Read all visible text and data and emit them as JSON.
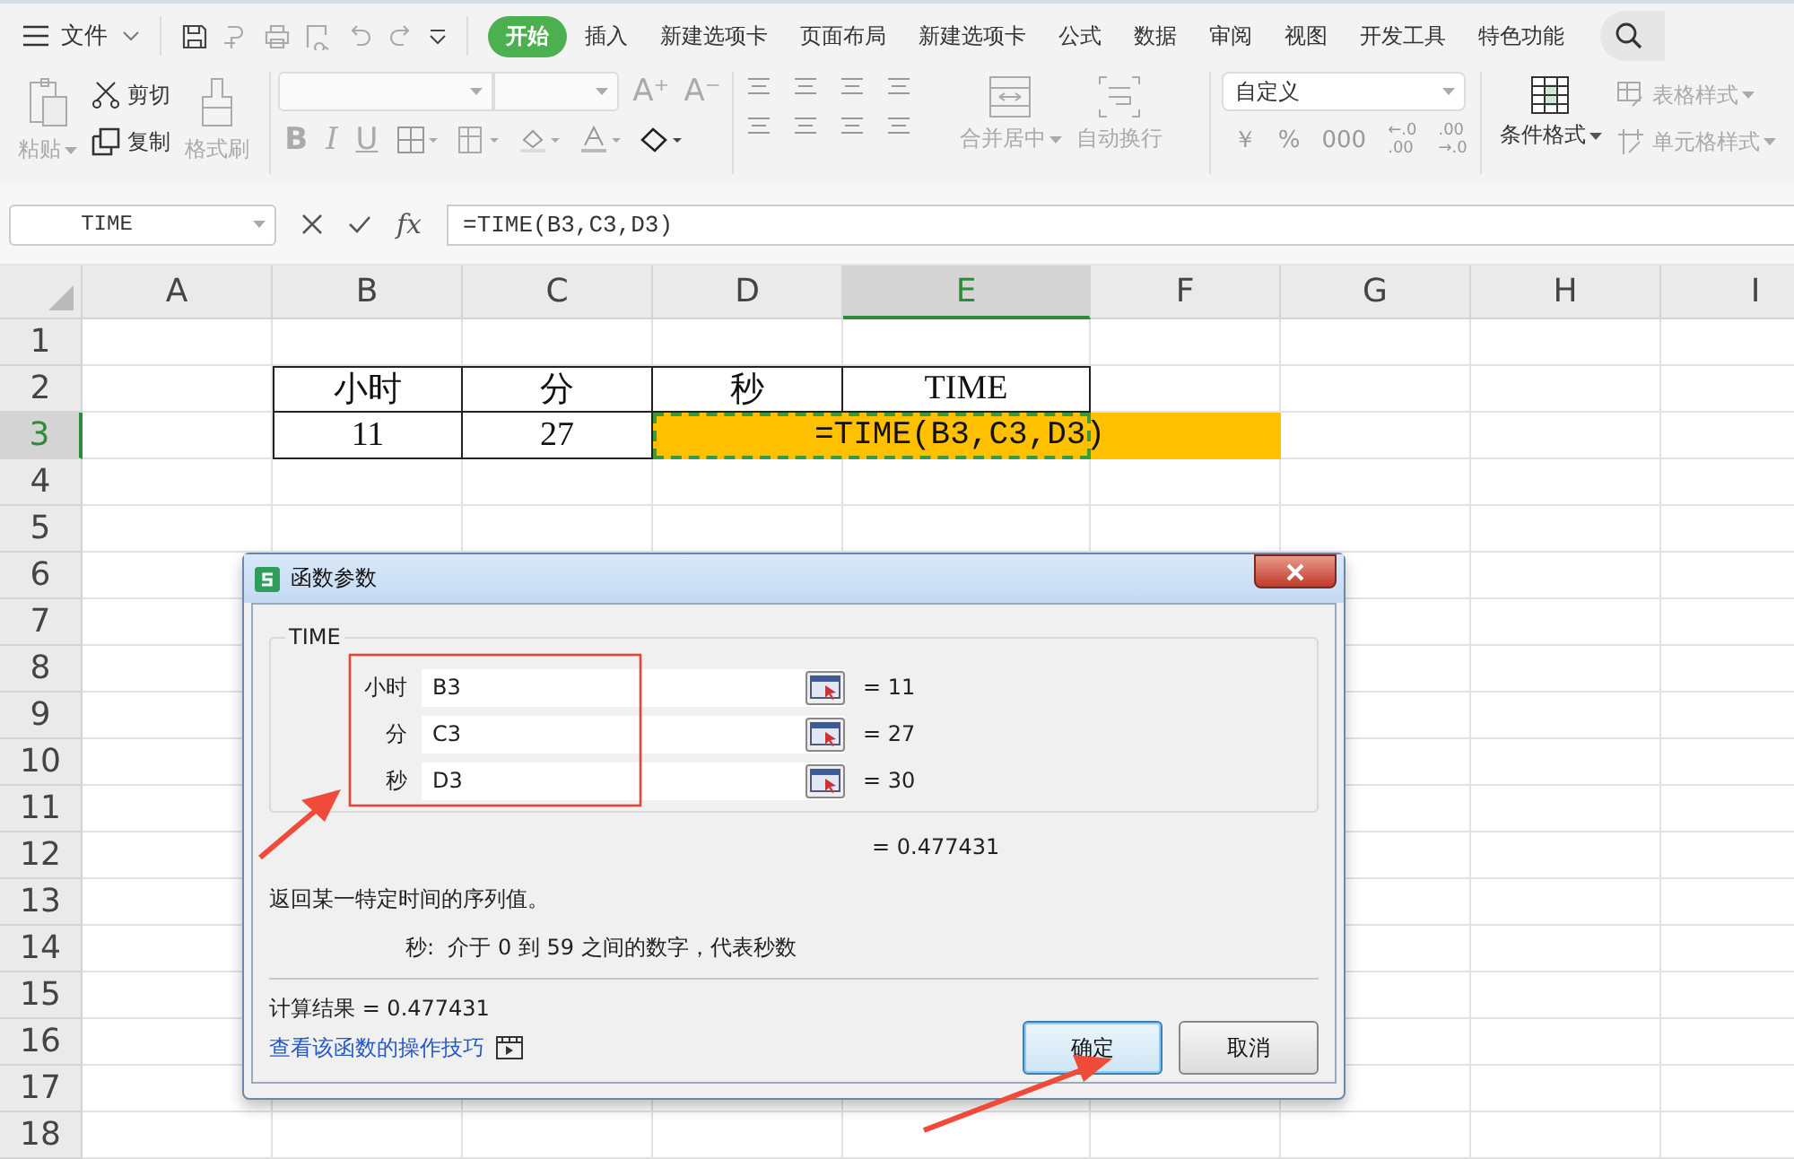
{
  "menu": {
    "file": "文件",
    "tabs": [
      {
        "label": "开始",
        "selected": true
      },
      {
        "label": "插入",
        "selected": false
      },
      {
        "label": "新建选项卡",
        "selected": false
      },
      {
        "label": "页面布局",
        "selected": false
      },
      {
        "label": "新建选项卡",
        "selected": false
      },
      {
        "label": "公式",
        "selected": false
      },
      {
        "label": "数据",
        "selected": false
      },
      {
        "label": "审阅",
        "selected": false
      },
      {
        "label": "视图",
        "selected": false
      },
      {
        "label": "开发工具",
        "selected": false
      },
      {
        "label": "特色功能",
        "selected": false
      }
    ]
  },
  "ribbon": {
    "paste": {
      "label": "粘贴",
      "disabled": true
    },
    "cut": {
      "label": "剪切",
      "disabled": false
    },
    "copy": {
      "label": "复制",
      "disabled": false
    },
    "format_painter": {
      "label": "格式刷",
      "disabled": true
    },
    "font_size_buttons": [
      "A⁺",
      "A⁻"
    ],
    "style_buttons": [
      "B",
      "I",
      "U"
    ],
    "merge": {
      "label": "合并居中",
      "disabled": true
    },
    "wrap": {
      "label": "自动换行",
      "disabled": true
    },
    "number_format": "自定义",
    "number_buttons": [
      {
        "kind": "text",
        "text": "￥"
      },
      {
        "kind": "text",
        "text": "%"
      },
      {
        "kind": "text",
        "text": "000"
      },
      {
        "kind": "decimal",
        "lines": [
          "←.0",
          ".00"
        ]
      },
      {
        "kind": "decimal",
        "lines": [
          ".00",
          "→.0"
        ]
      }
    ],
    "conditional": {
      "label": "条件格式",
      "disabled": false
    },
    "table_style": {
      "label": "表格样式",
      "disabled": true
    },
    "cell_style": {
      "label": "单元格样式",
      "disabled": true
    }
  },
  "formula_bar": {
    "name_box": "TIME",
    "fx": "fx",
    "formula": "=TIME(B3,C3,D3)"
  },
  "sheet": {
    "columns": [
      {
        "label": "A",
        "selected": false
      },
      {
        "label": "B",
        "selected": false
      },
      {
        "label": "C",
        "selected": false
      },
      {
        "label": "D",
        "selected": false
      },
      {
        "label": "E",
        "selected": true
      },
      {
        "label": "F",
        "selected": false
      },
      {
        "label": "G",
        "selected": false
      },
      {
        "label": "H",
        "selected": false
      },
      {
        "label": "I",
        "selected": false
      }
    ],
    "rows": [
      {
        "label": "1",
        "selected": false
      },
      {
        "label": "2",
        "selected": false
      },
      {
        "label": "3",
        "selected": true
      },
      {
        "label": "4",
        "selected": false
      },
      {
        "label": "5",
        "selected": false
      },
      {
        "label": "6",
        "selected": false
      },
      {
        "label": "7",
        "selected": false
      },
      {
        "label": "8",
        "selected": false
      },
      {
        "label": "9",
        "selected": false
      },
      {
        "label": "10",
        "selected": false
      },
      {
        "label": "11",
        "selected": false
      },
      {
        "label": "12",
        "selected": false
      },
      {
        "label": "13",
        "selected": false
      },
      {
        "label": "14",
        "selected": false
      },
      {
        "label": "15",
        "selected": false
      },
      {
        "label": "16",
        "selected": false
      },
      {
        "label": "17",
        "selected": false
      },
      {
        "label": "18",
        "selected": false
      }
    ],
    "table": {
      "headers": [
        "小时",
        "分",
        "秒",
        "TIME"
      ],
      "values": [
        "11",
        "27"
      ],
      "formula": "=TIME(B3,C3,D3)"
    }
  },
  "dialog": {
    "title": "函数参数",
    "function_name": "TIME",
    "arguments": [
      {
        "label": "小时",
        "value": "B3",
        "result": "= 11"
      },
      {
        "label": "分",
        "value": "C3",
        "result": "= 27"
      },
      {
        "label": "秒",
        "value": "D3",
        "result": "= 30"
      }
    ],
    "total": "= 0.477431",
    "description": "返回某一特定时间的序列值。",
    "argument_help": "秒:  介于 0 到 59 之间的数字，代表秒数",
    "result": "计算结果 = 0.477431",
    "help_link": "查看该函数的操作技巧",
    "buttons": [
      {
        "label": "确定",
        "default": true
      },
      {
        "label": "取消",
        "default": false
      }
    ]
  }
}
